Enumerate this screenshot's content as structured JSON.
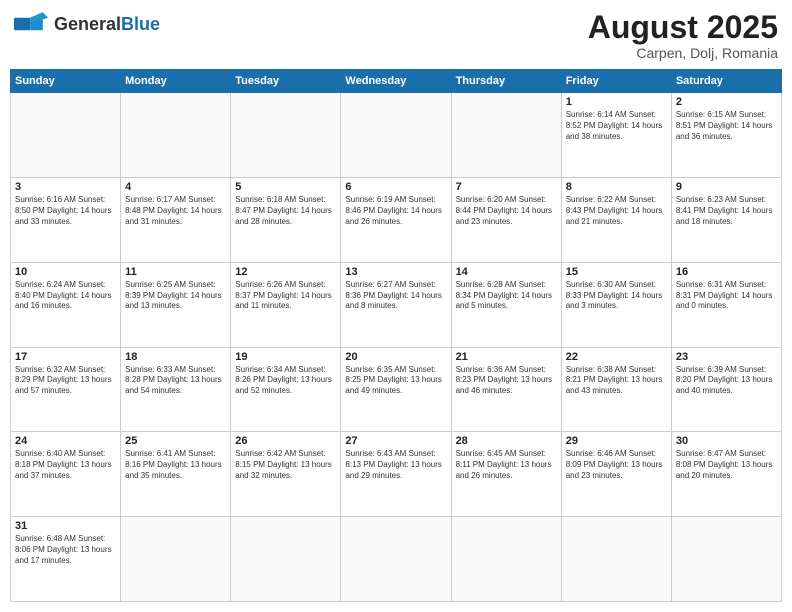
{
  "header": {
    "logo_general": "General",
    "logo_blue": "Blue",
    "main_title": "August 2025",
    "subtitle": "Carpen, Dolj, Romania"
  },
  "calendar": {
    "days_of_week": [
      "Sunday",
      "Monday",
      "Tuesday",
      "Wednesday",
      "Thursday",
      "Friday",
      "Saturday"
    ],
    "weeks": [
      [
        {
          "day": "",
          "info": ""
        },
        {
          "day": "",
          "info": ""
        },
        {
          "day": "",
          "info": ""
        },
        {
          "day": "",
          "info": ""
        },
        {
          "day": "",
          "info": ""
        },
        {
          "day": "1",
          "info": "Sunrise: 6:14 AM\nSunset: 8:52 PM\nDaylight: 14 hours and 38 minutes."
        },
        {
          "day": "2",
          "info": "Sunrise: 6:15 AM\nSunset: 8:51 PM\nDaylight: 14 hours and 36 minutes."
        }
      ],
      [
        {
          "day": "3",
          "info": "Sunrise: 6:16 AM\nSunset: 8:50 PM\nDaylight: 14 hours and 33 minutes."
        },
        {
          "day": "4",
          "info": "Sunrise: 6:17 AM\nSunset: 8:48 PM\nDaylight: 14 hours and 31 minutes."
        },
        {
          "day": "5",
          "info": "Sunrise: 6:18 AM\nSunset: 8:47 PM\nDaylight: 14 hours and 28 minutes."
        },
        {
          "day": "6",
          "info": "Sunrise: 6:19 AM\nSunset: 8:46 PM\nDaylight: 14 hours and 26 minutes."
        },
        {
          "day": "7",
          "info": "Sunrise: 6:20 AM\nSunset: 8:44 PM\nDaylight: 14 hours and 23 minutes."
        },
        {
          "day": "8",
          "info": "Sunrise: 6:22 AM\nSunset: 8:43 PM\nDaylight: 14 hours and 21 minutes."
        },
        {
          "day": "9",
          "info": "Sunrise: 6:23 AM\nSunset: 8:41 PM\nDaylight: 14 hours and 18 minutes."
        }
      ],
      [
        {
          "day": "10",
          "info": "Sunrise: 6:24 AM\nSunset: 8:40 PM\nDaylight: 14 hours and 16 minutes."
        },
        {
          "day": "11",
          "info": "Sunrise: 6:25 AM\nSunset: 8:39 PM\nDaylight: 14 hours and 13 minutes."
        },
        {
          "day": "12",
          "info": "Sunrise: 6:26 AM\nSunset: 8:37 PM\nDaylight: 14 hours and 11 minutes."
        },
        {
          "day": "13",
          "info": "Sunrise: 6:27 AM\nSunset: 8:36 PM\nDaylight: 14 hours and 8 minutes."
        },
        {
          "day": "14",
          "info": "Sunrise: 6:28 AM\nSunset: 8:34 PM\nDaylight: 14 hours and 5 minutes."
        },
        {
          "day": "15",
          "info": "Sunrise: 6:30 AM\nSunset: 8:33 PM\nDaylight: 14 hours and 3 minutes."
        },
        {
          "day": "16",
          "info": "Sunrise: 6:31 AM\nSunset: 8:31 PM\nDaylight: 14 hours and 0 minutes."
        }
      ],
      [
        {
          "day": "17",
          "info": "Sunrise: 6:32 AM\nSunset: 8:29 PM\nDaylight: 13 hours and 57 minutes."
        },
        {
          "day": "18",
          "info": "Sunrise: 6:33 AM\nSunset: 8:28 PM\nDaylight: 13 hours and 54 minutes."
        },
        {
          "day": "19",
          "info": "Sunrise: 6:34 AM\nSunset: 8:26 PM\nDaylight: 13 hours and 52 minutes."
        },
        {
          "day": "20",
          "info": "Sunrise: 6:35 AM\nSunset: 8:25 PM\nDaylight: 13 hours and 49 minutes."
        },
        {
          "day": "21",
          "info": "Sunrise: 6:36 AM\nSunset: 8:23 PM\nDaylight: 13 hours and 46 minutes."
        },
        {
          "day": "22",
          "info": "Sunrise: 6:38 AM\nSunset: 8:21 PM\nDaylight: 13 hours and 43 minutes."
        },
        {
          "day": "23",
          "info": "Sunrise: 6:39 AM\nSunset: 8:20 PM\nDaylight: 13 hours and 40 minutes."
        }
      ],
      [
        {
          "day": "24",
          "info": "Sunrise: 6:40 AM\nSunset: 8:18 PM\nDaylight: 13 hours and 37 minutes."
        },
        {
          "day": "25",
          "info": "Sunrise: 6:41 AM\nSunset: 8:16 PM\nDaylight: 13 hours and 35 minutes."
        },
        {
          "day": "26",
          "info": "Sunrise: 6:42 AM\nSunset: 8:15 PM\nDaylight: 13 hours and 32 minutes."
        },
        {
          "day": "27",
          "info": "Sunrise: 6:43 AM\nSunset: 8:13 PM\nDaylight: 13 hours and 29 minutes."
        },
        {
          "day": "28",
          "info": "Sunrise: 6:45 AM\nSunset: 8:11 PM\nDaylight: 13 hours and 26 minutes."
        },
        {
          "day": "29",
          "info": "Sunrise: 6:46 AM\nSunset: 8:09 PM\nDaylight: 13 hours and 23 minutes."
        },
        {
          "day": "30",
          "info": "Sunrise: 6:47 AM\nSunset: 8:08 PM\nDaylight: 13 hours and 20 minutes."
        }
      ],
      [
        {
          "day": "31",
          "info": "Sunrise: 6:48 AM\nSunset: 8:06 PM\nDaylight: 13 hours and 17 minutes."
        },
        {
          "day": "",
          "info": ""
        },
        {
          "day": "",
          "info": ""
        },
        {
          "day": "",
          "info": ""
        },
        {
          "day": "",
          "info": ""
        },
        {
          "day": "",
          "info": ""
        },
        {
          "day": "",
          "info": ""
        }
      ]
    ]
  }
}
